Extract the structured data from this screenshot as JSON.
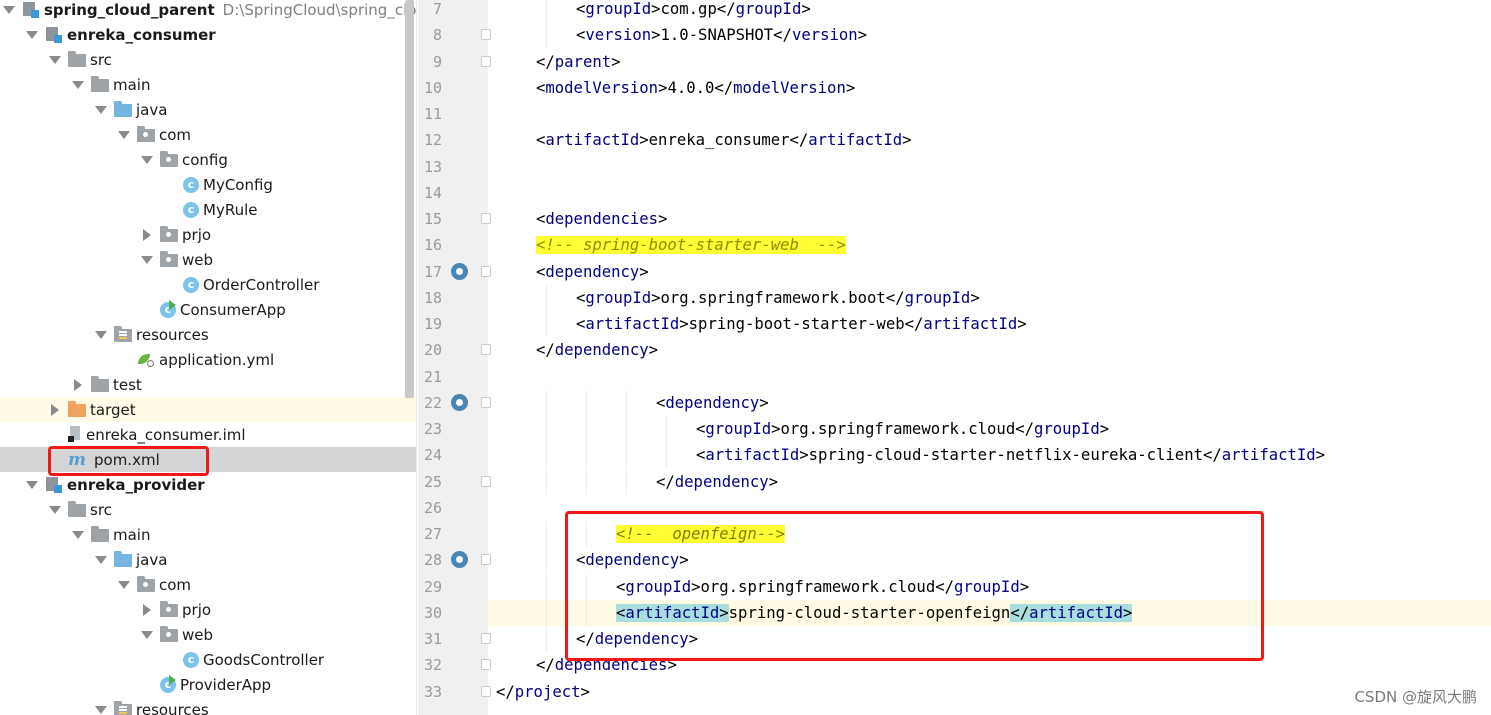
{
  "project_tree": {
    "items": [
      {
        "label": "spring_cloud_parent",
        "path": "D:\\SpringCloud\\spring_cloud",
        "icon": "module-icon",
        "arrow": "down",
        "depth": 0,
        "bold": true
      },
      {
        "label": "enreka_consumer",
        "icon": "module-icon",
        "arrow": "down",
        "depth": 1,
        "bold": true
      },
      {
        "label": "src",
        "icon": "folder-icon",
        "arrow": "down",
        "depth": 2
      },
      {
        "label": "main",
        "icon": "folder-icon",
        "arrow": "down",
        "depth": 3
      },
      {
        "label": "java",
        "icon": "source-folder-icon",
        "arrow": "down",
        "depth": 4
      },
      {
        "label": "com",
        "icon": "package-icon",
        "arrow": "down",
        "depth": 5
      },
      {
        "label": "config",
        "icon": "package-icon",
        "arrow": "down",
        "depth": 6
      },
      {
        "label": "MyConfig",
        "icon": "class-icon",
        "arrow": "none",
        "depth": 7
      },
      {
        "label": "MyRule",
        "icon": "class-icon",
        "arrow": "none",
        "depth": 7
      },
      {
        "label": "prjo",
        "icon": "package-icon",
        "arrow": "right",
        "depth": 6
      },
      {
        "label": "web",
        "icon": "package-icon",
        "arrow": "down",
        "depth": 6
      },
      {
        "label": "OrderController",
        "icon": "class-icon",
        "arrow": "none",
        "depth": 7
      },
      {
        "label": "ConsumerApp",
        "icon": "spring-app-icon",
        "arrow": "none",
        "depth": 6
      },
      {
        "label": "resources",
        "icon": "resources-folder-icon",
        "arrow": "down",
        "depth": 4
      },
      {
        "label": "application.yml",
        "icon": "yml-icon",
        "arrow": "none",
        "depth": 5
      },
      {
        "label": "test",
        "icon": "folder-icon",
        "arrow": "right",
        "depth": 3
      },
      {
        "label": "target",
        "icon": "excluded-folder-icon",
        "arrow": "right",
        "depth": 2
      },
      {
        "label": "enreka_consumer.iml",
        "icon": "iml-file-icon",
        "arrow": "none",
        "depth": 2
      },
      {
        "label": "pom.xml",
        "icon": "maven-icon",
        "arrow": "none",
        "depth": 2,
        "selected": true
      },
      {
        "label": "enreka_provider",
        "icon": "module-icon",
        "arrow": "down",
        "depth": 1,
        "bold": true
      },
      {
        "label": "src",
        "icon": "folder-icon",
        "arrow": "down",
        "depth": 2
      },
      {
        "label": "main",
        "icon": "folder-icon",
        "arrow": "down",
        "depth": 3
      },
      {
        "label": "java",
        "icon": "source-folder-icon",
        "arrow": "down",
        "depth": 4
      },
      {
        "label": "com",
        "icon": "package-icon",
        "arrow": "down",
        "depth": 5
      },
      {
        "label": "prjo",
        "icon": "package-icon",
        "arrow": "right",
        "depth": 6
      },
      {
        "label": "web",
        "icon": "package-icon",
        "arrow": "down",
        "depth": 6
      },
      {
        "label": "GoodsController",
        "icon": "class-icon",
        "arrow": "none",
        "depth": 7
      },
      {
        "label": "ProviderApp",
        "icon": "spring-app-icon",
        "arrow": "none",
        "depth": 6
      },
      {
        "label": "resources",
        "icon": "resources-folder-icon",
        "arrow": "down",
        "depth": 4
      }
    ]
  },
  "editor": {
    "lines": [
      {
        "n": "7",
        "indent": 2,
        "segments": [
          [
            "br",
            "<"
          ],
          [
            "tag",
            "groupId"
          ],
          [
            "br",
            ">com.gp</"
          ],
          [
            "tag",
            "groupId"
          ],
          [
            "br",
            ">"
          ]
        ]
      },
      {
        "n": "8",
        "indent": 2,
        "fold": true,
        "segments": [
          [
            "br",
            "<"
          ],
          [
            "tag",
            "version"
          ],
          [
            "br",
            ">1.0-SNAPSHOT</"
          ],
          [
            "tag",
            "version"
          ],
          [
            "br",
            ">"
          ]
        ]
      },
      {
        "n": "9",
        "indent": 1,
        "fold": true,
        "segments": [
          [
            "br",
            "</"
          ],
          [
            "tag",
            "parent"
          ],
          [
            "br",
            ">"
          ]
        ]
      },
      {
        "n": "10",
        "indent": 1,
        "segments": [
          [
            "br",
            "<"
          ],
          [
            "tag",
            "modelVersion"
          ],
          [
            "br",
            ">4.0.0</"
          ],
          [
            "tag",
            "modelVersion"
          ],
          [
            "br",
            ">"
          ]
        ]
      },
      {
        "n": "11",
        "indent": 1,
        "segments": []
      },
      {
        "n": "12",
        "indent": 1,
        "segments": [
          [
            "br",
            "<"
          ],
          [
            "tag",
            "artifactId"
          ],
          [
            "br",
            ">enreka_consumer</"
          ],
          [
            "tag",
            "artifactId"
          ],
          [
            "br",
            ">"
          ]
        ]
      },
      {
        "n": "13",
        "indent": 1,
        "segments": []
      },
      {
        "n": "14",
        "indent": 1,
        "segments": []
      },
      {
        "n": "15",
        "indent": 1,
        "fold": true,
        "segments": [
          [
            "br",
            "<"
          ],
          [
            "tag",
            "dependencies"
          ],
          [
            "br",
            ">"
          ]
        ]
      },
      {
        "n": "16",
        "indent": 1,
        "segments": [
          [
            "cmt",
            "<!-- spring-boot-starter-web  -->"
          ]
        ]
      },
      {
        "n": "17",
        "indent": 1,
        "fold": true,
        "gicon": true,
        "segments": [
          [
            "br",
            "<"
          ],
          [
            "tag",
            "dependency"
          ],
          [
            "br",
            ">"
          ]
        ]
      },
      {
        "n": "18",
        "indent": 2,
        "segments": [
          [
            "br",
            "<"
          ],
          [
            "tag",
            "groupId"
          ],
          [
            "br",
            ">org.springframework.boot</"
          ],
          [
            "tag",
            "groupId"
          ],
          [
            "br",
            ">"
          ]
        ]
      },
      {
        "n": "19",
        "indent": 2,
        "segments": [
          [
            "br",
            "<"
          ],
          [
            "tag",
            "artifactId"
          ],
          [
            "br",
            ">spring-boot-starter-web</"
          ],
          [
            "tag",
            "artifactId"
          ],
          [
            "br",
            ">"
          ]
        ]
      },
      {
        "n": "20",
        "indent": 1,
        "fold": true,
        "segments": [
          [
            "br",
            "</"
          ],
          [
            "tag",
            "dependency"
          ],
          [
            "br",
            ">"
          ]
        ]
      },
      {
        "n": "21",
        "indent": 1,
        "segments": []
      },
      {
        "n": "22",
        "indent": 4,
        "fold": true,
        "gicon": true,
        "segments": [
          [
            "br",
            "<"
          ],
          [
            "tag",
            "dependency"
          ],
          [
            "br",
            ">"
          ]
        ]
      },
      {
        "n": "23",
        "indent": 5,
        "segments": [
          [
            "br",
            "<"
          ],
          [
            "tag",
            "groupId"
          ],
          [
            "br",
            ">org.springframework.cloud</"
          ],
          [
            "tag",
            "groupId"
          ],
          [
            "br",
            ">"
          ]
        ]
      },
      {
        "n": "24",
        "indent": 5,
        "segments": [
          [
            "br",
            "<"
          ],
          [
            "tag",
            "artifactId"
          ],
          [
            "br",
            ">spring-cloud-starter-netflix-eureka-client</"
          ],
          [
            "tag",
            "artifactId"
          ],
          [
            "br",
            ">"
          ]
        ]
      },
      {
        "n": "25",
        "indent": 4,
        "fold": true,
        "segments": [
          [
            "br",
            "</"
          ],
          [
            "tag",
            "dependency"
          ],
          [
            "br",
            ">"
          ]
        ]
      },
      {
        "n": "26",
        "indent": 1,
        "segments": []
      },
      {
        "n": "27",
        "indent": 3,
        "segments": [
          [
            "cmt2",
            "<!--  openfeign-->"
          ]
        ]
      },
      {
        "n": "28",
        "indent": 2,
        "fold": true,
        "gicon": true,
        "segments": [
          [
            "br",
            "<"
          ],
          [
            "tag",
            "dependency"
          ],
          [
            "br",
            ">"
          ]
        ]
      },
      {
        "n": "29",
        "indent": 3,
        "segments": [
          [
            "br",
            "<"
          ],
          [
            "tag",
            "groupId"
          ],
          [
            "br",
            ">org.springframework.cloud</"
          ],
          [
            "tag",
            "groupId"
          ],
          [
            "br",
            ">"
          ]
        ]
      },
      {
        "n": "30",
        "indent": 3,
        "current": true,
        "segments": [
          [
            "match",
            "<"
          ],
          [
            "tagm",
            "artifactId"
          ],
          [
            "match",
            ">"
          ],
          [
            "br",
            "spring-cloud-starter-openfeign"
          ],
          [
            "match",
            "</"
          ],
          [
            "tagm",
            "artifactId"
          ],
          [
            "match",
            ">"
          ]
        ]
      },
      {
        "n": "31",
        "indent": 2,
        "fold": true,
        "segments": [
          [
            "br",
            "</"
          ],
          [
            "tag",
            "dependency"
          ],
          [
            "br",
            ">"
          ]
        ]
      },
      {
        "n": "32",
        "indent": 1,
        "fold": true,
        "segments": [
          [
            "br",
            "</"
          ],
          [
            "tag",
            "dependencies"
          ],
          [
            "br",
            ">"
          ]
        ]
      },
      {
        "n": "33",
        "indent": 0,
        "fold": true,
        "segments": [
          [
            "br",
            "</"
          ],
          [
            "tag",
            "project"
          ],
          [
            "br",
            ">"
          ]
        ]
      }
    ]
  },
  "watermark": "CSDN @旋风大鹏",
  "colors": {
    "tag": "#000080",
    "annotation": "#f21818",
    "comment_bg": "#ffff33",
    "selection": "#d5d5d5"
  }
}
